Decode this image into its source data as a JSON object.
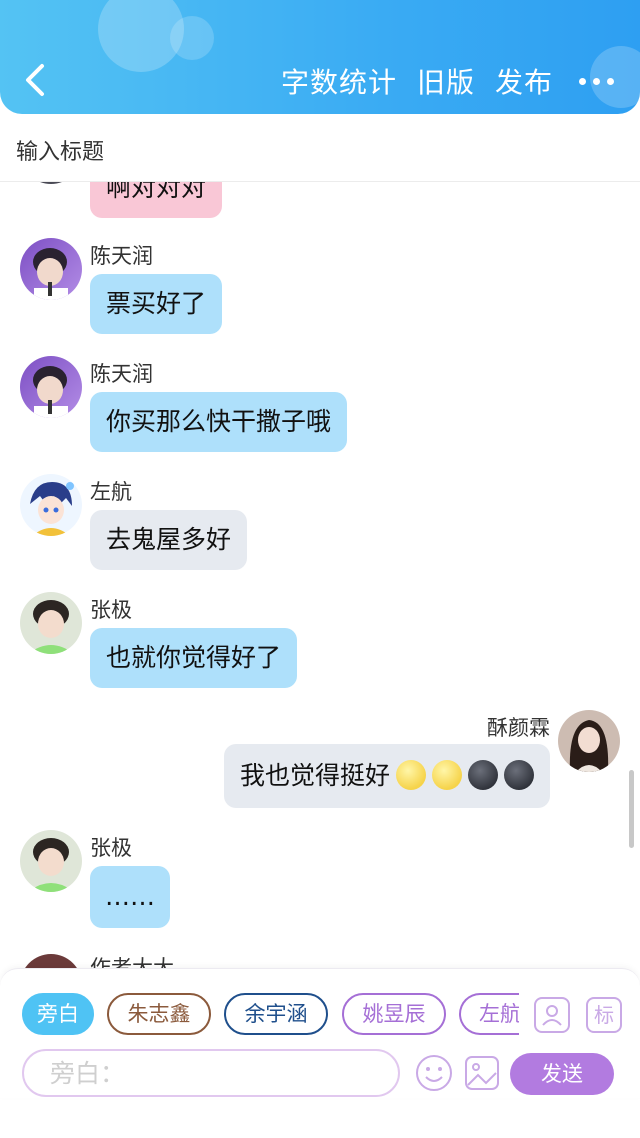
{
  "header": {
    "back_icon": "chevron-left-icon",
    "actions": [
      "字数统计",
      "旧版",
      "发布"
    ],
    "more_icon": "more-dots-icon",
    "background": "#3aabf3"
  },
  "title_bar": {
    "placeholder": "输入标题"
  },
  "messages": [
    {
      "id": "m0",
      "side": "left",
      "name": "",
      "text": "啊对对对",
      "bubble_color": "pink"
    },
    {
      "id": "m1",
      "side": "left",
      "name": "陈天润",
      "text": "票买好了",
      "bubble_color": "blue"
    },
    {
      "id": "m2",
      "side": "left",
      "name": "陈天润",
      "text": "你买那么快干撒子哦",
      "bubble_color": "blue"
    },
    {
      "id": "m3",
      "side": "left",
      "name": "左航",
      "text": "去鬼屋多好",
      "bubble_color": "gray"
    },
    {
      "id": "m4",
      "side": "left",
      "name": "张极",
      "text": "也就你觉得好了",
      "bubble_color": "blue"
    },
    {
      "id": "m5",
      "side": "right",
      "name": "酥颜霖",
      "text": "我也觉得挺好",
      "emojis": [
        "sun-face-icon",
        "sun-face-icon",
        "new-moon-face-icon",
        "new-moon-face-icon"
      ],
      "bubble_color": "gray"
    },
    {
      "id": "m6",
      "side": "left",
      "name": "张极",
      "text": "……",
      "bubble_color": "blue"
    },
    {
      "id": "m7",
      "side": "left",
      "name": "作者大大",
      "text": "",
      "bubble_color": ""
    }
  ],
  "roles": [
    {
      "label": "旁白",
      "active": true,
      "color": "#4fc3f4"
    },
    {
      "label": "朱志鑫",
      "active": false,
      "color": "#8b5a3c"
    },
    {
      "label": "余宇涵",
      "active": false,
      "color": "#1f4f8c"
    },
    {
      "label": "姚昱辰",
      "active": false,
      "color": "#a56fd6"
    },
    {
      "label": "左航",
      "active": false,
      "color": "#a56fd6"
    }
  ],
  "tools": {
    "person_icon": "person-card-icon",
    "tag_label": "标"
  },
  "composer": {
    "placeholder": "旁白：",
    "emoji_icon": "smiley-icon",
    "image_icon": "image-icon",
    "send_label": "发送",
    "accent": "#b27be0"
  }
}
